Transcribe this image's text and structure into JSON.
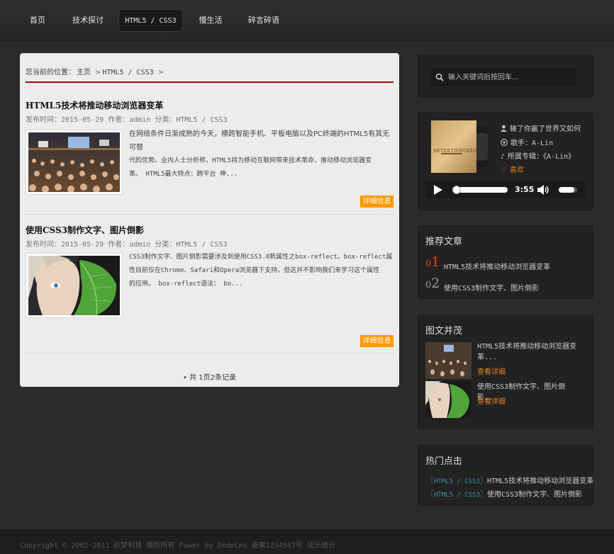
{
  "nav": {
    "items": [
      {
        "label": "首页"
      },
      {
        "label": "技术探讨"
      },
      {
        "label": "HTML5 / CSS3"
      },
      {
        "label": "慢生活"
      },
      {
        "label": "碎言碎语"
      }
    ]
  },
  "breadcrumb": {
    "prefix": "您当前的位置：",
    "home": "主页",
    "current": "HTML5 / CSS3",
    "sep": ">"
  },
  "articles": [
    {
      "title": "HTML5技术将推动移动浏览器变革",
      "meta": "发布时间：2015-05-29 作者：admin 分类：HTML5 / CSS3",
      "excerpt_lines": [
        "在网络条件日渐成熟的今天，横跨智能手机、平板电脑以及PC终端的HTML5有其无可替",
        "代的优势。业内人士分析称，HTML5将为移动互联网带来技术革命，推动移动浏览器变",
        "革。 HTML5最大特点：跨平台 神..."
      ],
      "more": "详细信息"
    },
    {
      "title": "使用CSS3制作文字、图片倒影",
      "meta": "发布时间：2015-05-29 作者：admin 分类：HTML5 / CSS3",
      "excerpt_lines": [
        "CSS3制作文字、图片倒影需要涉及到使用CSS3.0新属性之box-reflect。box-reflect属",
        "性目前仅在Chrome、Safari和Opera浏览器下支持，但这并不影响我们来学习这个属性",
        "的应用。 box-reflect语法： bo..."
      ],
      "more": "详细信息"
    }
  ],
  "pager": {
    "text": "• 共 1页2条记录"
  },
  "search": {
    "placeholder": "输入关键词后按回车..."
  },
  "player": {
    "album_text": "DETEKTIVBYRÅN",
    "song": "输了你赢了世界又如何",
    "singer": "歌手：A-Lin",
    "album": "所属专辑：《A-Lin》",
    "like": "喜欢",
    "time": "3:55",
    "progress": 0.08,
    "volume": 0.85
  },
  "recommend": {
    "title": "推荐文章",
    "items": [
      {
        "num": "01",
        "text": "HTML5技术将推动移动浏览器变革"
      },
      {
        "num": "02",
        "text": "使用CSS3制作文字、图片倒影"
      }
    ]
  },
  "pictext": {
    "title": "图文并茂",
    "items": [
      {
        "title": "HTML5技术将推动移动浏览器变革...",
        "more": "查看详细"
      },
      {
        "title": "使用CSS3制作文字、图片倒影...",
        "more": "查看详细"
      }
    ]
  },
  "hot": {
    "title": "热门点击",
    "items": [
      {
        "open": "〖",
        "cat": "HTML5 / CSS3",
        "close": "〗",
        "text": "HTML5技术将推动移动浏览器变革"
      },
      {
        "open": "〖",
        "cat": "HTML5 / CSS3",
        "close": "〗",
        "text": "使用CSS3制作文字、图片倒影"
      }
    ]
  },
  "footer": {
    "text": "Copyright © 2002-2011 织梦科技 版权所有 Power by DedeCms 备案1234567号 站长统计"
  },
  "colors": {
    "accent": "#ff9900",
    "red": "#b00000",
    "link_orange": "#e8822a",
    "hot_cat": "#3f8f9f"
  }
}
